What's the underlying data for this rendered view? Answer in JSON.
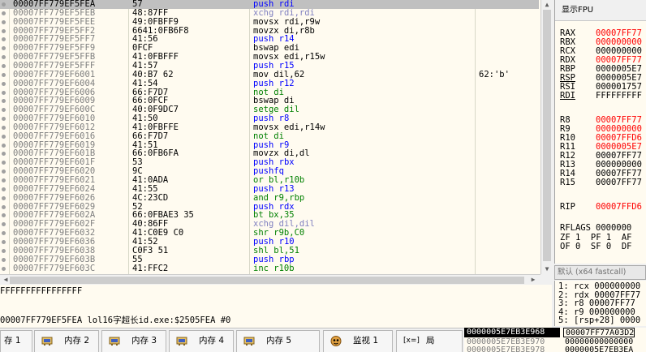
{
  "disasm": {
    "rows": [
      {
        "addr": "00007FF779EF5FEA",
        "hex": "57",
        "mnem": "push",
        "ops": " rdi",
        "cls": "c-push",
        "sel": true,
        "cmt": ""
      },
      {
        "addr": "00007FF779EF5FEB",
        "hex": "48:87FF",
        "mnem": "xchg",
        "ops": " rdi,rdi",
        "cls": "c-xchg",
        "sel": false,
        "cmt": ""
      },
      {
        "addr": "00007FF779EF5FEE",
        "hex": "49:0FBFF9",
        "mnem": "movsx",
        "ops": " rdi,r9w",
        "cls": "c-mov",
        "sel": false,
        "cmt": ""
      },
      {
        "addr": "00007FF779EF5FF2",
        "hex": "6641:0FB6F8",
        "mnem": "movzx",
        "ops": " di,r8b",
        "cls": "c-mov",
        "sel": false,
        "cmt": ""
      },
      {
        "addr": "00007FF779EF5FF7",
        "hex": "41:56",
        "mnem": "push",
        "ops": " r14",
        "cls": "c-push",
        "sel": false,
        "cmt": ""
      },
      {
        "addr": "00007FF779EF5FF9",
        "hex": "0FCF",
        "mnem": "bswap",
        "ops": " edi",
        "cls": "c-mov",
        "sel": false,
        "cmt": ""
      },
      {
        "addr": "00007FF779EF5FFB",
        "hex": "41:0FBFFF",
        "mnem": "movsx",
        "ops": " edi,r15w",
        "cls": "c-mov",
        "sel": false,
        "cmt": ""
      },
      {
        "addr": "00007FF779EF5FFF",
        "hex": "41:57",
        "mnem": "push",
        "ops": " r15",
        "cls": "c-push",
        "sel": false,
        "cmt": ""
      },
      {
        "addr": "00007FF779EF6001",
        "hex": "40:B7 62",
        "mnem": "mov",
        "ops": " dil,62",
        "cls": "c-mov",
        "sel": false,
        "cmt": "62:'b'"
      },
      {
        "addr": "00007FF779EF6004",
        "hex": "41:54",
        "mnem": "push",
        "ops": " r12",
        "cls": "c-push",
        "sel": false,
        "cmt": ""
      },
      {
        "addr": "00007FF779EF6006",
        "hex": "66:F7D7",
        "mnem": "not",
        "ops": " di",
        "cls": "c-bit",
        "sel": false,
        "cmt": ""
      },
      {
        "addr": "00007FF779EF6009",
        "hex": "66:0FCF",
        "mnem": "bswap",
        "ops": " di",
        "cls": "c-mov",
        "sel": false,
        "cmt": ""
      },
      {
        "addr": "00007FF779EF600C",
        "hex": "40:0F9DC7",
        "mnem": "setge",
        "ops": " dil",
        "cls": "c-bit",
        "sel": false,
        "cmt": ""
      },
      {
        "addr": "00007FF779EF6010",
        "hex": "41:50",
        "mnem": "push",
        "ops": " r8",
        "cls": "c-push",
        "sel": false,
        "cmt": ""
      },
      {
        "addr": "00007FF779EF6012",
        "hex": "41:0FBFFE",
        "mnem": "movsx",
        "ops": " edi,r14w",
        "cls": "c-mov",
        "sel": false,
        "cmt": ""
      },
      {
        "addr": "00007FF779EF6016",
        "hex": "66:F7D7",
        "mnem": "not",
        "ops": " di",
        "cls": "c-bit",
        "sel": false,
        "cmt": ""
      },
      {
        "addr": "00007FF779EF6019",
        "hex": "41:51",
        "mnem": "push",
        "ops": " r9",
        "cls": "c-push",
        "sel": false,
        "cmt": ""
      },
      {
        "addr": "00007FF779EF601B",
        "hex": "66:0FB6FA",
        "mnem": "movzx",
        "ops": " di,dl",
        "cls": "c-mov",
        "sel": false,
        "cmt": ""
      },
      {
        "addr": "00007FF779EF601F",
        "hex": "53",
        "mnem": "push",
        "ops": " rbx",
        "cls": "c-push",
        "sel": false,
        "cmt": ""
      },
      {
        "addr": "00007FF779EF6020",
        "hex": "9C",
        "mnem": "pushfq",
        "ops": "",
        "cls": "c-push",
        "sel": false,
        "cmt": ""
      },
      {
        "addr": "00007FF779EF6021",
        "hex": "41:0ADA",
        "mnem": "or",
        "ops": " bl,r10b",
        "cls": "c-bit",
        "sel": false,
        "cmt": ""
      },
      {
        "addr": "00007FF779EF6024",
        "hex": "41:55",
        "mnem": "push",
        "ops": " r13",
        "cls": "c-push",
        "sel": false,
        "cmt": ""
      },
      {
        "addr": "00007FF779EF6026",
        "hex": "4C:23CD",
        "mnem": "and",
        "ops": " r9,rbp",
        "cls": "c-bit",
        "sel": false,
        "cmt": ""
      },
      {
        "addr": "00007FF779EF6029",
        "hex": "52",
        "mnem": "push",
        "ops": " rdx",
        "cls": "c-push",
        "sel": false,
        "cmt": ""
      },
      {
        "addr": "00007FF779EF602A",
        "hex": "66:0FBAE3 35",
        "mnem": "bt",
        "ops": " bx,35",
        "cls": "c-bit",
        "sel": false,
        "cmt": ""
      },
      {
        "addr": "00007FF779EF602F",
        "hex": "40:86FF",
        "mnem": "xchg",
        "ops": " dil,dil",
        "cls": "c-xchg",
        "sel": false,
        "cmt": ""
      },
      {
        "addr": "00007FF779EF6032",
        "hex": "41:C0E9 C0",
        "mnem": "shr",
        "ops": " r9b,C0",
        "cls": "c-bit",
        "sel": false,
        "cmt": ""
      },
      {
        "addr": "00007FF779EF6036",
        "hex": "41:52",
        "mnem": "push",
        "ops": " r10",
        "cls": "c-push",
        "sel": false,
        "cmt": ""
      },
      {
        "addr": "00007FF779EF6038",
        "hex": "C0F3 51",
        "mnem": "shl",
        "ops": " bl,51",
        "cls": "c-bit",
        "sel": false,
        "cmt": ""
      },
      {
        "addr": "00007FF779EF603B",
        "hex": "55",
        "mnem": "push",
        "ops": " rbp",
        "cls": "c-push",
        "sel": false,
        "cmt": ""
      },
      {
        "addr": "00007FF779EF603C",
        "hex": "41:FFC2",
        "mnem": "inc",
        "ops": " r10b",
        "cls": "c-bit",
        "sel": false,
        "cmt": ""
      }
    ]
  },
  "registers": {
    "header": "显示FPU",
    "groups": [
      [
        {
          "name": "RAX",
          "value": "00007FF77",
          "red": true,
          "ul": false
        },
        {
          "name": "RBX",
          "value": "000000000",
          "red": true,
          "ul": false
        },
        {
          "name": "RCX",
          "value": "000000000",
          "red": false,
          "ul": false
        },
        {
          "name": "RDX",
          "value": "00007FF77",
          "red": true,
          "ul": false
        },
        {
          "name": "RBP",
          "value": "0000005E7",
          "red": false,
          "ul": false
        },
        {
          "name": "RSP",
          "value": "0000005E7",
          "red": false,
          "ul": true
        },
        {
          "name": "RSI",
          "value": "000001757",
          "red": false,
          "ul": false
        },
        {
          "name": "RDI",
          "value": "FFFFFFFFF",
          "red": false,
          "ul": true
        }
      ],
      [
        {
          "name": "R8",
          "value": "00007FF77",
          "red": true,
          "ul": false
        },
        {
          "name": "R9",
          "value": "000000000",
          "red": true,
          "ul": false
        },
        {
          "name": "R10",
          "value": "00007FFD6",
          "red": true,
          "ul": false
        },
        {
          "name": "R11",
          "value": "0000005E7",
          "red": true,
          "ul": false
        },
        {
          "name": "R12",
          "value": "00007FF77",
          "red": false,
          "ul": false
        },
        {
          "name": "R13",
          "value": "000000000",
          "red": false,
          "ul": false
        },
        {
          "name": "R14",
          "value": "00007FF77",
          "red": false,
          "ul": false
        },
        {
          "name": "R15",
          "value": "00007FF77",
          "red": false,
          "ul": false
        }
      ],
      [
        {
          "name": "RIP",
          "value": "00007FFD6",
          "red": true,
          "ul": false
        }
      ]
    ],
    "rflags_label": "RFLAGS",
    "rflags_value": "0000000",
    "flags_line1": "ZF 1  PF 1  AF",
    "flags_line2": "OF 0  SF 0  DF"
  },
  "callconv": "默认 (x64 fastcall)",
  "callstack": [
    "1: rcx 000000000",
    "2: rdx 00007FF77",
    "3: r8 00007FF77",
    "4: r9 000000000",
    "5: [rsp+28] 0000"
  ],
  "info": {
    "line1": "FFFFFFFFFFFFFFFF",
    "line2": "00007FF779EF5FEA lol16字超长id.exe:$2505FEA #0"
  },
  "tabs": [
    {
      "label": "存 1",
      "icon": "memory-icon"
    },
    {
      "label": "内存 2",
      "icon": "memory-icon"
    },
    {
      "label": "内存 3",
      "icon": "memory-icon"
    },
    {
      "label": "内存 4",
      "icon": "memory-icon"
    },
    {
      "label": "内存 5",
      "icon": "memory-icon"
    },
    {
      "label": "监视 1",
      "icon": "watch-icon"
    },
    {
      "label": "局",
      "icon": "locals-icon"
    }
  ],
  "tab_locals_glyph": "[x=]",
  "stack": {
    "current": "0000005E7EB3E968",
    "current_value": "00007FF77A03D2",
    "rows": [
      {
        "addr": "0000005E7EB3E970",
        "value": "00000000000000"
      },
      {
        "addr": "0000005E7EB3E978",
        "value": "0000005E7EB3EA"
      }
    ]
  },
  "colors": {
    "push": "#0000ff",
    "selected_row": "#c0c0c0",
    "changed_register": "#ff0000",
    "pane_background": "#fffbf0"
  }
}
